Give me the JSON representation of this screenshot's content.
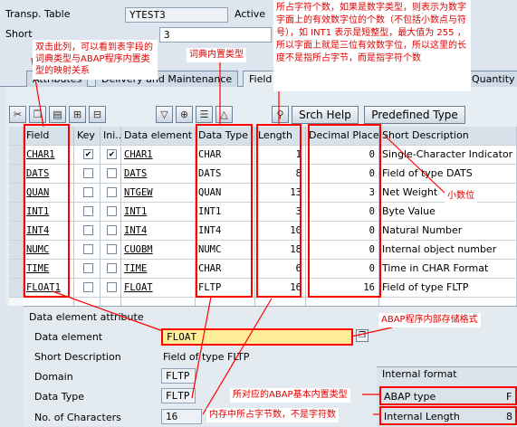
{
  "header": {
    "transp_table_label": "Transp. Table",
    "transp_table_value": "YTEST3",
    "status_label": "Active",
    "short_label": "Short",
    "short_value": "3"
  },
  "tabs": [
    "Attributes",
    "Delivery and Maintenance",
    "Field",
    "Quantity F"
  ],
  "toolbar": {
    "icons": [
      "cut-icon",
      "copy-icon",
      "paste-icon",
      "insert-row-icon",
      "delete-row-icon",
      "filter-icon",
      "search-icon",
      "select-icon",
      "up-icon",
      "search-help-icon"
    ],
    "srch_help": "Srch Help",
    "predefined_type": "Predefined Type"
  },
  "table": {
    "columns": [
      "Field",
      "Key",
      "Ini...",
      "Data element",
      "Data Type",
      "Length",
      "Decimal Places",
      "Short Description"
    ],
    "rows": [
      {
        "field": "CHAR1",
        "key": true,
        "ini": true,
        "element": "CHAR1",
        "type": "CHAR",
        "length": "1",
        "decimals": "0",
        "desc": "Single-Character Indicator"
      },
      {
        "field": "DATS",
        "key": false,
        "ini": false,
        "element": "DATS",
        "type": "DATS",
        "length": "8",
        "decimals": "0",
        "desc": "Field of type DATS"
      },
      {
        "field": "QUAN",
        "key": false,
        "ini": false,
        "element": "NTGEW",
        "type": "QUAN",
        "length": "13",
        "decimals": "3",
        "desc": "Net Weight"
      },
      {
        "field": "INT1",
        "key": false,
        "ini": false,
        "element": "INT1",
        "type": "INT1",
        "length": "3",
        "decimals": "0",
        "desc": "Byte Value"
      },
      {
        "field": "INT4",
        "key": false,
        "ini": false,
        "element": "INT4",
        "type": "INT4",
        "length": "10",
        "decimals": "0",
        "desc": "Natural Number"
      },
      {
        "field": "NUMC",
        "key": false,
        "ini": false,
        "element": "CUOBM",
        "type": "NUMC",
        "length": "18",
        "decimals": "0",
        "desc": "Internal object number"
      },
      {
        "field": "TIME",
        "key": false,
        "ini": false,
        "element": "TIME",
        "type": "CHAR",
        "length": "6",
        "decimals": "0",
        "desc": "Time in CHAR Format"
      },
      {
        "field": "FLOAT1",
        "key": false,
        "ini": false,
        "element": "FLOAT",
        "type": "FLTP",
        "length": "16",
        "decimals": "16",
        "desc": "Field of type FLTP"
      }
    ]
  },
  "attr": {
    "title": "Data element attribute",
    "data_element_label": "Data element",
    "data_element_value": "FLOAT",
    "short_desc_label": "Short Description",
    "short_desc_value": "Field of type FLTP",
    "domain_label": "Domain",
    "domain_value": "FLTP",
    "data_type_label": "Data Type",
    "data_type_value": "FLTP",
    "num_chars_label": "No. of Characters",
    "num_chars_value": "16"
  },
  "internal": {
    "title": "Internal format",
    "abap_type_label": "ABAP type",
    "abap_type_value": "F",
    "internal_length_label": "Internal Length",
    "internal_length_value": "8"
  },
  "annotations": {
    "col_mapping": "双击此列，可以看到表字段的词典类型与ABAP程序内置类型的映射关系",
    "dict_type": "词典内置类型",
    "length_note": "所占字符个数，如果是数字类型，则表示为数字字面上的有效数字位的个数（不包括小数点与符号），如 INT1 表示是短整型，最大值为 255 ，所以字面上就是三位有效数字位，所以这里的长度不是指所占字节，而是指字符个数",
    "decimals": "小数位",
    "abap_storage": "ABAP程序内部存储格式",
    "abap_builtin": "所对应的ABAP基本内置类型",
    "bytes_note": "内存中所占字节数，不是字符数"
  }
}
